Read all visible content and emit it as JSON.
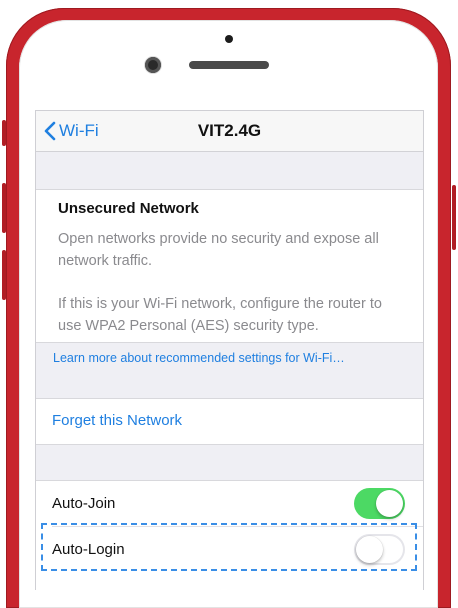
{
  "navbar": {
    "back_label": "Wi-Fi",
    "title": "VIT2.4G"
  },
  "info": {
    "title": "Unsecured Network",
    "text1": "Open networks provide no security and expose all network traffic.",
    "text2": "If this is your Wi-Fi network, configure the router to use WPA2 Personal (AES) security type."
  },
  "learn_more": "Learn more about recommended settings for Wi-Fi…",
  "forget": "Forget this Network",
  "toggles": [
    {
      "label": "Auto-Join",
      "on": true
    },
    {
      "label": "Auto-Login",
      "on": false
    }
  ],
  "colors": {
    "accent": "#1f7fe0",
    "switch_on": "#4cd964",
    "phone": "#c8252d",
    "highlight": "#3a8ee6"
  },
  "icons": {
    "back": "chevron-left-icon"
  }
}
